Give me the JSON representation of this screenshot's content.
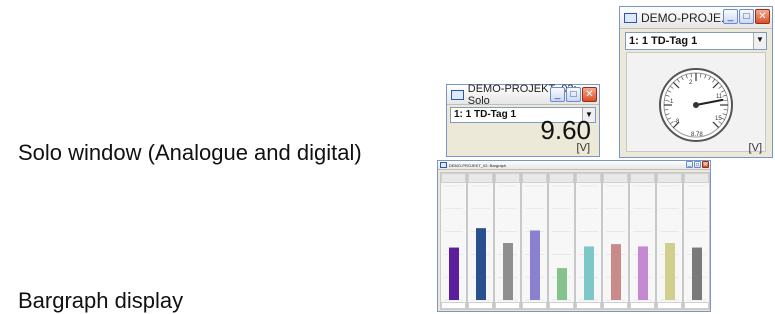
{
  "captions": {
    "solo": "Solo window (Analogue and digital)",
    "bargraph": "Bargraph display"
  },
  "solo_window": {
    "title": "DEMO-PROJEKT_02: Solo",
    "channel": "1: 1 TD-Tag 1",
    "value": "9.60",
    "unit": "[V]"
  },
  "gauge_window": {
    "title": "DEMO-PROJE...",
    "channel": "1: 1 TD-Tag 1",
    "unit": "[V]",
    "scale_labels": [
      "-8",
      "-1",
      "2",
      "11",
      "15"
    ],
    "readout": "8.78",
    "needle_value": 8.78,
    "scale_min": -15,
    "scale_max": 15
  },
  "bargraph_window": {
    "title": "DEMO-PROJEKT_02: Bargraph",
    "bars": [
      {
        "fill": 0.46,
        "color": "#5b1f9e"
      },
      {
        "fill": 0.63,
        "color": "#2a4f8f"
      },
      {
        "fill": 0.5,
        "color": "#8f8f8f"
      },
      {
        "fill": 0.61,
        "color": "#8a80d0"
      },
      {
        "fill": 0.28,
        "color": "#86c28e"
      },
      {
        "fill": 0.47,
        "color": "#7ec7c9"
      },
      {
        "fill": 0.49,
        "color": "#c98a8a"
      },
      {
        "fill": 0.47,
        "color": "#c389d3"
      },
      {
        "fill": 0.5,
        "color": "#d0cf8e"
      },
      {
        "fill": 0.46,
        "color": "#7a7a7a"
      }
    ]
  },
  "icons": {
    "minimize": "minimize-icon",
    "maximize": "maximize-icon",
    "close": "close-icon",
    "dropdown": "chevron-down-icon"
  }
}
